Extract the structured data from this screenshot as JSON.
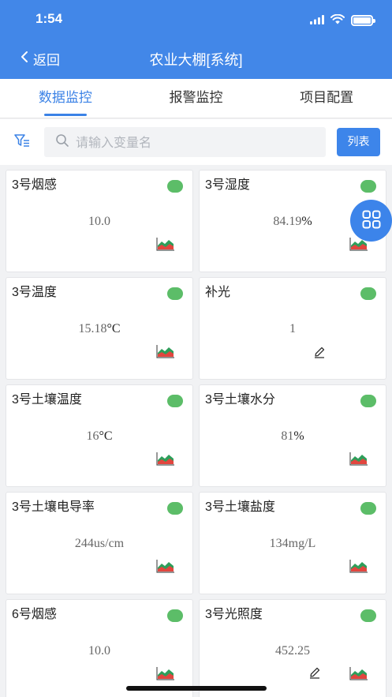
{
  "status_bar": {
    "time": "1:54"
  },
  "nav": {
    "back_label": "返回",
    "title": "农业大棚[系统]"
  },
  "tabs": [
    {
      "label": "数据监控",
      "active": true
    },
    {
      "label": "报警监控",
      "active": false
    },
    {
      "label": "项目配置",
      "active": false
    }
  ],
  "search": {
    "placeholder": "请输入变量名",
    "list_button": "列表"
  },
  "colors": {
    "primary": "#4287e8",
    "status_online": "#5cbd68"
  },
  "cards": [
    {
      "name": "3号烟感",
      "value": "10.0",
      "unit": "",
      "status": "online",
      "has_chart": true,
      "has_edit": false
    },
    {
      "name": "3号湿度",
      "value": "84.19",
      "unit": "%",
      "status": "online",
      "has_chart": true,
      "has_edit": false
    },
    {
      "name": "3号温度",
      "value": "15.18",
      "unit": "°C",
      "status": "online",
      "has_chart": true,
      "has_edit": false
    },
    {
      "name": "补光",
      "value": "1",
      "unit": "",
      "status": "online",
      "has_chart": false,
      "has_edit": true
    },
    {
      "name": "3号土壤温度",
      "value": "16",
      "unit": "°C",
      "status": "online",
      "has_chart": true,
      "has_edit": false
    },
    {
      "name": "3号土壤水分",
      "value": "81",
      "unit": "%",
      "status": "online",
      "has_chart": true,
      "has_edit": false
    },
    {
      "name": "3号土壤电导率",
      "value": "244us/cm",
      "unit": "",
      "status": "online",
      "has_chart": true,
      "has_edit": false
    },
    {
      "name": "3号土壤盐度",
      "value": "134mg/L",
      "unit": "",
      "status": "online",
      "has_chart": true,
      "has_edit": false
    },
    {
      "name": "6号烟感",
      "value": "10.0",
      "unit": "",
      "status": "online",
      "has_chart": true,
      "has_edit": false
    },
    {
      "name": "3号光照度",
      "value": "452.25",
      "unit": "",
      "status": "online",
      "has_chart": true,
      "has_edit": true
    }
  ],
  "icons": {
    "back": "chevron-left-icon",
    "filter": "filter-icon",
    "search": "search-icon",
    "status": "status-dot-icon",
    "chart": "area-chart-icon",
    "edit": "pencil-icon",
    "fab": "grid-icon"
  }
}
